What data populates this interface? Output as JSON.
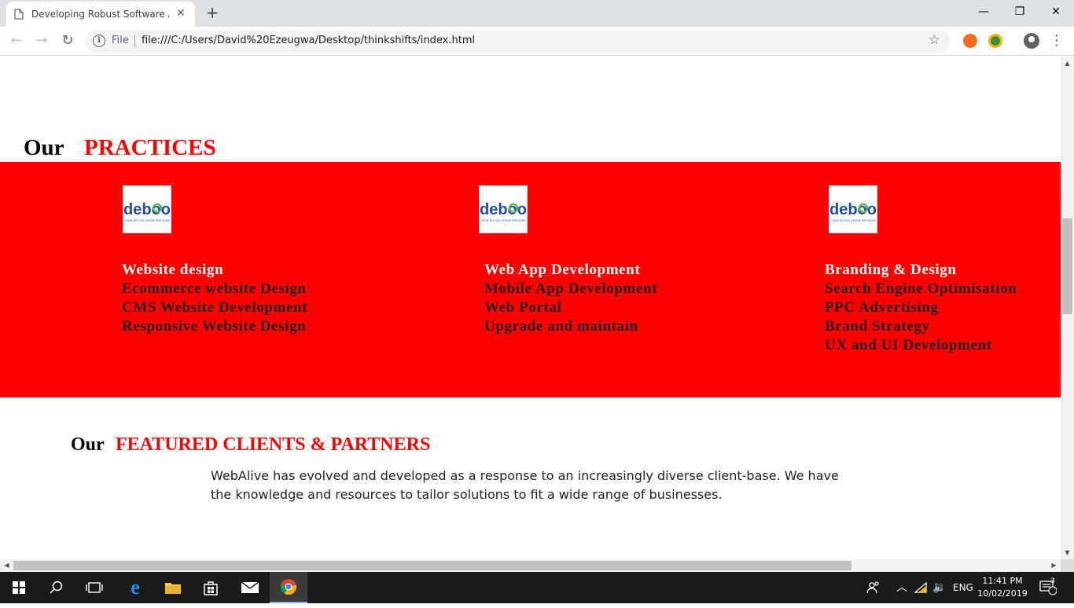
{
  "browser": {
    "tab_title": "Developing Robust Software App",
    "tab_close": "✕",
    "new_tab": "+",
    "minimize": "—",
    "maximize": "❐",
    "close": "✕",
    "back": "←",
    "forward": "→",
    "reload": "↻",
    "info_icon": "i",
    "scheme_label": "File",
    "url": "file:///C:/Users/David%20Ezeugwa/Desktop/thinkshifts/index.html",
    "star": "☆",
    "menu": "⋮"
  },
  "practices": {
    "heading_prefix": "Our",
    "heading_highlight": "PRACTICES",
    "logo_text": "deboo",
    "logo_tagline": "YOUR SEO SOLUTIONS PROVIDER",
    "columns": [
      {
        "items": [
          "Website design",
          "Ecommerce website Design",
          "CMS Website Development",
          "Responsive Website Design"
        ]
      },
      {
        "items": [
          "Web App Development",
          "Mobile App Development",
          "Web Portal",
          "Upgrade and maintain"
        ]
      },
      {
        "items": [
          "Branding & Design",
          "Search Engine Optimisation",
          "PPC Advertising",
          "Brand Strategy",
          "UX and UI Development"
        ]
      }
    ]
  },
  "clients": {
    "heading_prefix": "Our",
    "heading_highlight": "FEATURED CLIENTS & PARTNERS",
    "description": "WebAlive has evolved and developed as a response to an increasingly diverse client-base. We have the knowledge and resources to tailor solutions to fit a wide range of businesses."
  },
  "taskbar": {
    "language": "ENG",
    "time": "11:41 PM",
    "date": "10/02/2019",
    "notification_count": "3"
  },
  "colors": {
    "brand_red": "#ff0000",
    "logo_blue": "#1f4e9c",
    "logo_green": "#5cb85c"
  }
}
